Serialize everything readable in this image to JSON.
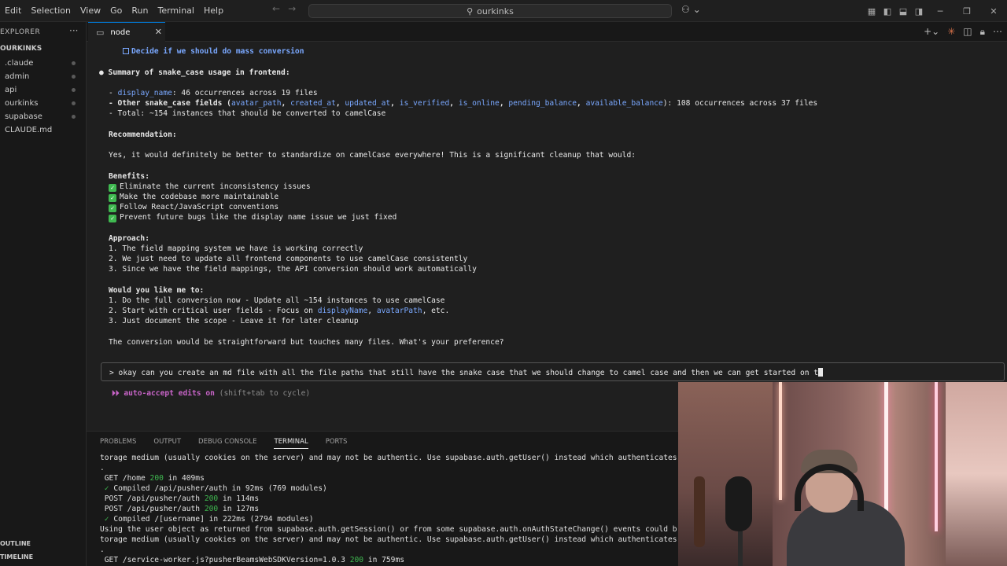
{
  "menu": [
    "Edit",
    "Selection",
    "View",
    "Go",
    "Run",
    "Terminal",
    "Help"
  ],
  "search": {
    "text": "ourkinks"
  },
  "sidebar": {
    "title": "EXPLORER",
    "project": "OURKINKS",
    "items": [
      ".claude",
      "admin",
      "api",
      "ourkinks",
      "supabase",
      "CLAUDE.md"
    ],
    "outline": "OUTLINE",
    "timeline": "TIMELINE"
  },
  "tab": {
    "label": "node"
  },
  "editor": {
    "l0": "Decide if we should do mass conversion",
    "l1": "● Summary of snake_case usage in frontend:",
    "l2a": "- ",
    "l2b": "display_name",
    "l2c": ": 46 occurrences across 19 files",
    "l3a": "- Other snake_case fields (",
    "l3fields": [
      "avatar_path",
      "created_at",
      "updated_at",
      "is_verified",
      "is_online",
      "pending_balance",
      "available_balance"
    ],
    "l3c": "): 108 occurrences across 37 files",
    "l4": "- Total: ~154 instances that should be converted to camelCase",
    "l5": "Recommendation:",
    "l6": "Yes, it would definitely be better to standardize on camelCase everywhere! This is a significant cleanup that would:",
    "l7": "Benefits:",
    "benefits": [
      "Eliminate the current inconsistency issues",
      "Make the codebase more maintainable",
      "Follow React/JavaScript conventions",
      "Prevent future bugs like the display name issue we just fixed"
    ],
    "l8": "Approach:",
    "approach": [
      "1. The field mapping system we have is working correctly",
      "2. We just need to update all frontend components to use camelCase consistently",
      "3. Since we have the field mappings, the API conversion should work automatically"
    ],
    "l9": "Would you like me to:",
    "o1": "1. Do the full conversion now - Update all ~154 instances to use camelCase",
    "o2a": "2. Start with critical user fields - Focus on ",
    "o2b": "displayName",
    "o2c": ", ",
    "o2d": "avatarPath",
    "o2e": ", etc.",
    "o3": "3. Just document the scope - Leave it for later cleanup",
    "l10": "The conversion would be straightforward but touches many files. What's your preference?",
    "prompt": "> okay can you create an md file with all the file paths that still have the snake case that we should change to camel case and then we can get started on t",
    "auto_on": "⏵⏵ auto-accept edits on",
    "auto_hint": " (shift+tab to cycle)"
  },
  "panel_tabs": [
    "PROBLEMS",
    "OUTPUT",
    "DEBUG CONSOLE",
    "TERMINAL",
    "PORTS"
  ],
  "terminal": {
    "t1": "torage medium (usually cookies on the server) and may not be authentic. Use supabase.auth.getUser() instead which authenticates",
    "t2": ".",
    "t3a": " GET /home ",
    "t3s": "200",
    "t3b": " in 409ms",
    "t4a": " ✓",
    "t4b": " Compiled /api/pusher/auth in 92ms (769 modules)",
    "t5a": " POST /api/pusher/auth ",
    "t5s": "200",
    "t5b": " in 114ms",
    "t6a": " POST /api/pusher/auth ",
    "t6s": "200",
    "t6b": " in 127ms",
    "t7a": " ✓",
    "t7b": " Compiled /[username] in 222ms (2794 modules)",
    "t8": "Using the user object as returned from supabase.auth.getSession() or from some supabase.auth.onAuthStateChange() events could b",
    "t9": "torage medium (usually cookies on the server) and may not be authentic. Use supabase.auth.getUser() instead which authenticates",
    "t10": ".",
    "t11a": " GET /service-worker.js?pusherBeamsWebSDKVersion=1.0.3 ",
    "t11s": "200",
    "t11b": " in 759ms"
  },
  "colors": {
    "accent": "#0078d4",
    "code": "#7aa8ff",
    "success": "#3fb950",
    "autoaccept": "#c864c8"
  }
}
